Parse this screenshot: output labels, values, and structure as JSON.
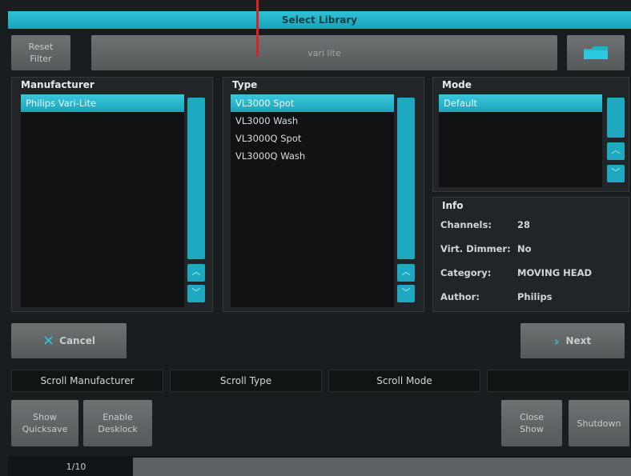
{
  "window": {
    "title": "Select Library"
  },
  "toolbar": {
    "reset_filter_label": "Reset\nFilter",
    "search_value": "vari lite",
    "folder_icon": "folder-icon"
  },
  "manufacturer": {
    "label": "Manufacturer",
    "items": [
      "Philips Vari-Lite"
    ],
    "selected_index": 0
  },
  "type": {
    "label": "Type",
    "items": [
      "VL3000 Spot",
      "VL3000 Wash",
      "VL3000Q Spot",
      "VL3000Q Wash"
    ],
    "selected_index": 0
  },
  "mode": {
    "label": "Mode",
    "items": [
      "Default"
    ],
    "selected_index": 0
  },
  "info": {
    "label": "Info",
    "rows": [
      {
        "key": "Channels:",
        "value": "28"
      },
      {
        "key": "Virt. Dimmer:",
        "value": "No"
      },
      {
        "key": "Category:",
        "value": "MOVING HEAD"
      },
      {
        "key": "Author:",
        "value": "Philips"
      }
    ]
  },
  "actions": {
    "cancel_label": "Cancel",
    "next_label": "Next"
  },
  "softkeys": [
    "Scroll Manufacturer",
    "Scroll Type",
    "Scroll Mode",
    ""
  ],
  "bottom_buttons": {
    "show_quicksave": "Show\nQuicksave",
    "enable_desklock": "Enable\nDesklock",
    "close_show": "Close\nShow",
    "shutdown": "Shutdown"
  },
  "page_indicator": "1/10",
  "colors": {
    "accent": "#1fa9c0",
    "background": "#1a1d1f",
    "button": "#5f6364"
  }
}
